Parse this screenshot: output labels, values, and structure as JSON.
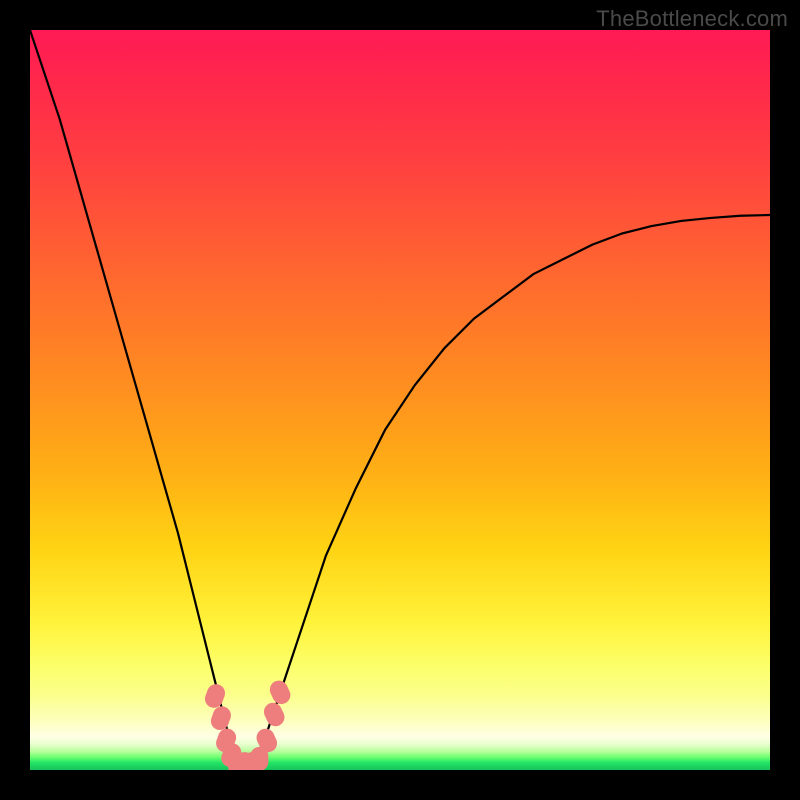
{
  "watermark": "TheBottleneck.com",
  "colors": {
    "curve_stroke": "#000000",
    "marker_fill": "#ee7d7d",
    "marker_outline": "#e96c6c",
    "frame_bg": "#000000"
  },
  "chart_data": {
    "type": "line",
    "title": "",
    "xlabel": "",
    "ylabel": "",
    "xlim": [
      0,
      100
    ],
    "ylim": [
      0,
      100
    ],
    "notch_x": 28,
    "right_end_y": 75,
    "series": [
      {
        "name": "bottleneck-curve",
        "x": [
          0,
          2,
          4,
          6,
          8,
          10,
          12,
          14,
          16,
          18,
          20,
          22,
          24,
          25,
          26,
          27,
          28,
          29,
          30,
          31,
          32,
          34,
          36,
          38,
          40,
          44,
          48,
          52,
          56,
          60,
          64,
          68,
          72,
          76,
          80,
          84,
          88,
          92,
          96,
          100
        ],
        "y": [
          100,
          94,
          88,
          81,
          74,
          67,
          60,
          53,
          46,
          39,
          32,
          24,
          16,
          12,
          8,
          4,
          1.5,
          0.7,
          0.7,
          2,
          5,
          11,
          17,
          23,
          29,
          38,
          46,
          52,
          57,
          61,
          64,
          67,
          69,
          71,
          72.5,
          73.5,
          74.2,
          74.6,
          74.9,
          75
        ]
      }
    ],
    "markers": [
      {
        "x": 25.0,
        "y": 10.0
      },
      {
        "x": 25.8,
        "y": 7.0
      },
      {
        "x": 26.5,
        "y": 4.0
      },
      {
        "x": 27.2,
        "y": 2.0
      },
      {
        "x": 28.0,
        "y": 0.8
      },
      {
        "x": 29.0,
        "y": 0.8
      },
      {
        "x": 30.0,
        "y": 0.8
      },
      {
        "x": 31.0,
        "y": 1.5
      },
      {
        "x": 32.0,
        "y": 4.0
      },
      {
        "x": 33.0,
        "y": 7.5
      },
      {
        "x": 33.8,
        "y": 10.5
      }
    ]
  }
}
